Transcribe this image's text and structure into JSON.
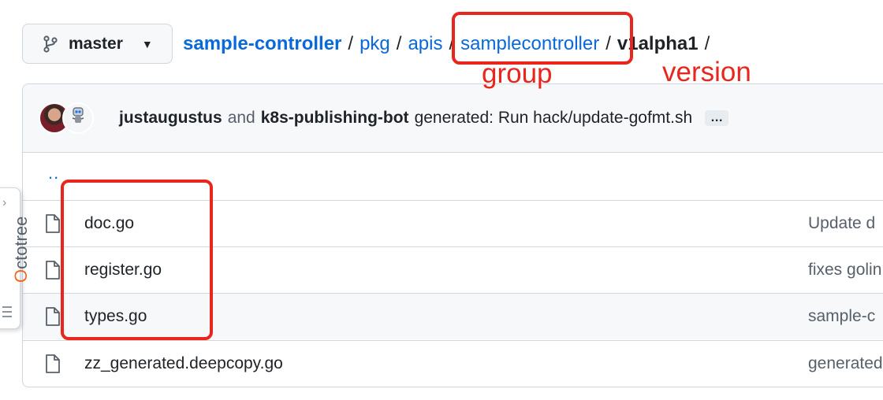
{
  "branch": {
    "label": "master",
    "icon": "git-branch-icon"
  },
  "breadcrumb": {
    "repo": "sample-controller",
    "sep": "/",
    "parts": [
      "pkg",
      "apis",
      "samplecontroller"
    ],
    "current": "v1alpha1"
  },
  "annotations": {
    "group_label": "group",
    "version_label": "version",
    "color": "#e8261e"
  },
  "commit": {
    "author1": "justaugustus",
    "and": "and",
    "author2": "k8s-publishing-bot",
    "message": "generated: Run hack/update-gofmt.sh",
    "ellipsis": "…"
  },
  "files": {
    "parent": "..",
    "rows": [
      {
        "name": "doc.go",
        "commit": "Update d"
      },
      {
        "name": "register.go",
        "commit": "fixes golin"
      },
      {
        "name": "types.go",
        "commit": "sample-c"
      },
      {
        "name": "zz_generated.deepcopy.go",
        "commit": "generated"
      }
    ]
  },
  "octotree": {
    "label_first": "O",
    "label_rest": "ctotree"
  },
  "colors": {
    "link": "#0969da",
    "accent_annotation": "#e8261e",
    "octotree_orange": "#f0671f"
  }
}
